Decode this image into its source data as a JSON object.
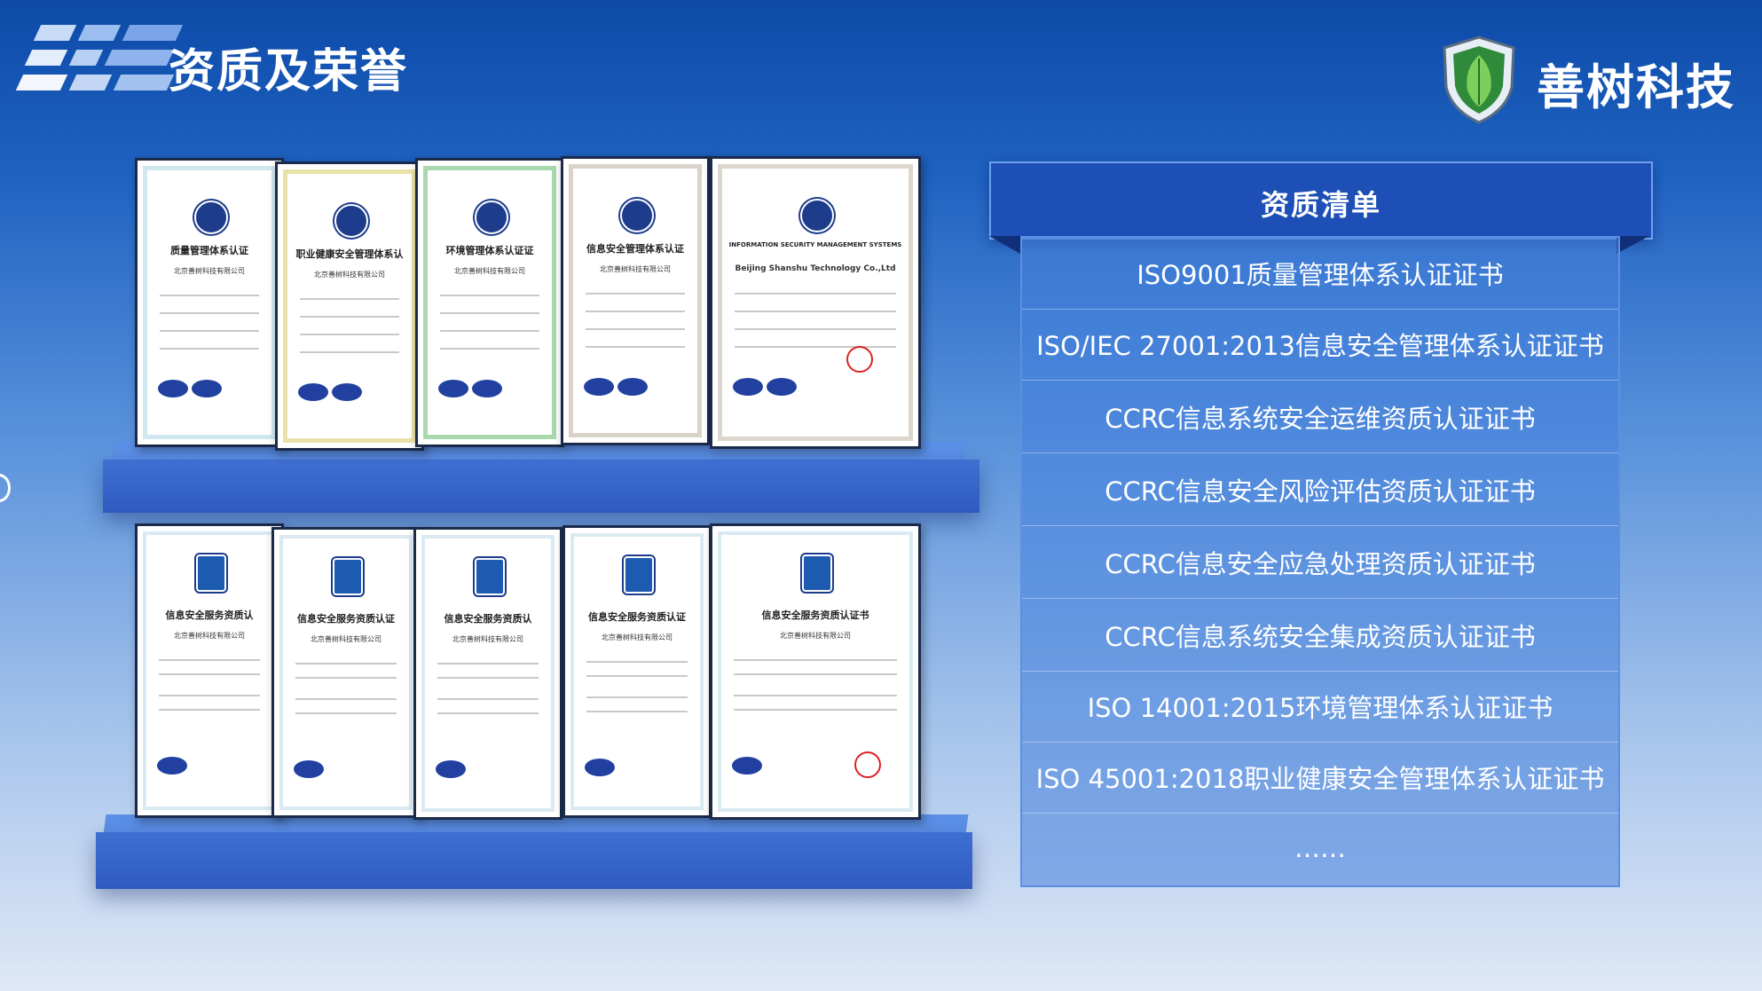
{
  "header": {
    "title": "资质及荣誉",
    "brand_name": "善树科技"
  },
  "colors": {
    "panel_header": "#1e4fb6",
    "panel_body": "#4682dc",
    "shelf": "#3f6fd2",
    "accent_white": "#ffffff"
  },
  "certificates": {
    "top_row": [
      {
        "title": "质量管理体系认证",
        "company": "北京善树科技有限公司",
        "color": "#cfe7ef"
      },
      {
        "title": "职业健康安全管理体系认",
        "company": "北京善树科技有限公司",
        "color": "#e9e2a8"
      },
      {
        "title": "环境管理体系认证证",
        "company": "北京善树科技有限公司",
        "color": "#a9d8ae"
      },
      {
        "title": "信息安全管理体系认证",
        "company": "北京善树科技有限公司",
        "color": "#d8d2c8"
      },
      {
        "title": "INFORMATION SECURITY MANAGEMENT SYSTEMS",
        "company": "Beijing Shanshu Technology Co.,Ltd",
        "color": "#dcd6cc"
      }
    ],
    "bottom_row": [
      {
        "title": "信息安全服务资质认",
        "company": "北京善树科技有限公司",
        "color": "#dbeaf2"
      },
      {
        "title": "信息安全服务资质认证",
        "company": "北京善树科技有限公司",
        "color": "#dbeaf2"
      },
      {
        "title": "信息安全服务资质认",
        "company": "北京善树科技有限公司",
        "color": "#dbeaf2"
      },
      {
        "title": "信息安全服务资质认证",
        "company": "北京善树科技有限公司",
        "color": "#dbeaf2"
      },
      {
        "title": "信息安全服务资质认证书",
        "company": "北京善树科技有限公司",
        "color": "#dbeaf2"
      }
    ]
  },
  "qualification_list": {
    "header": "资质清单",
    "items": [
      "ISO9001质量管理体系认证证书",
      "ISO/IEC 27001:2013信息安全管理体系认证证书",
      "CCRC信息系统安全运维资质认证证书",
      "CCRC信息安全风险评估资质认证证书",
      "CCRC信息安全应急处理资质认证证书",
      "CCRC信息系统安全集成资质认证证书",
      "ISO 14001:2015环境管理体系认证证书",
      "ISO 45001:2018职业健康安全管理体系认证证书",
      "……"
    ]
  }
}
